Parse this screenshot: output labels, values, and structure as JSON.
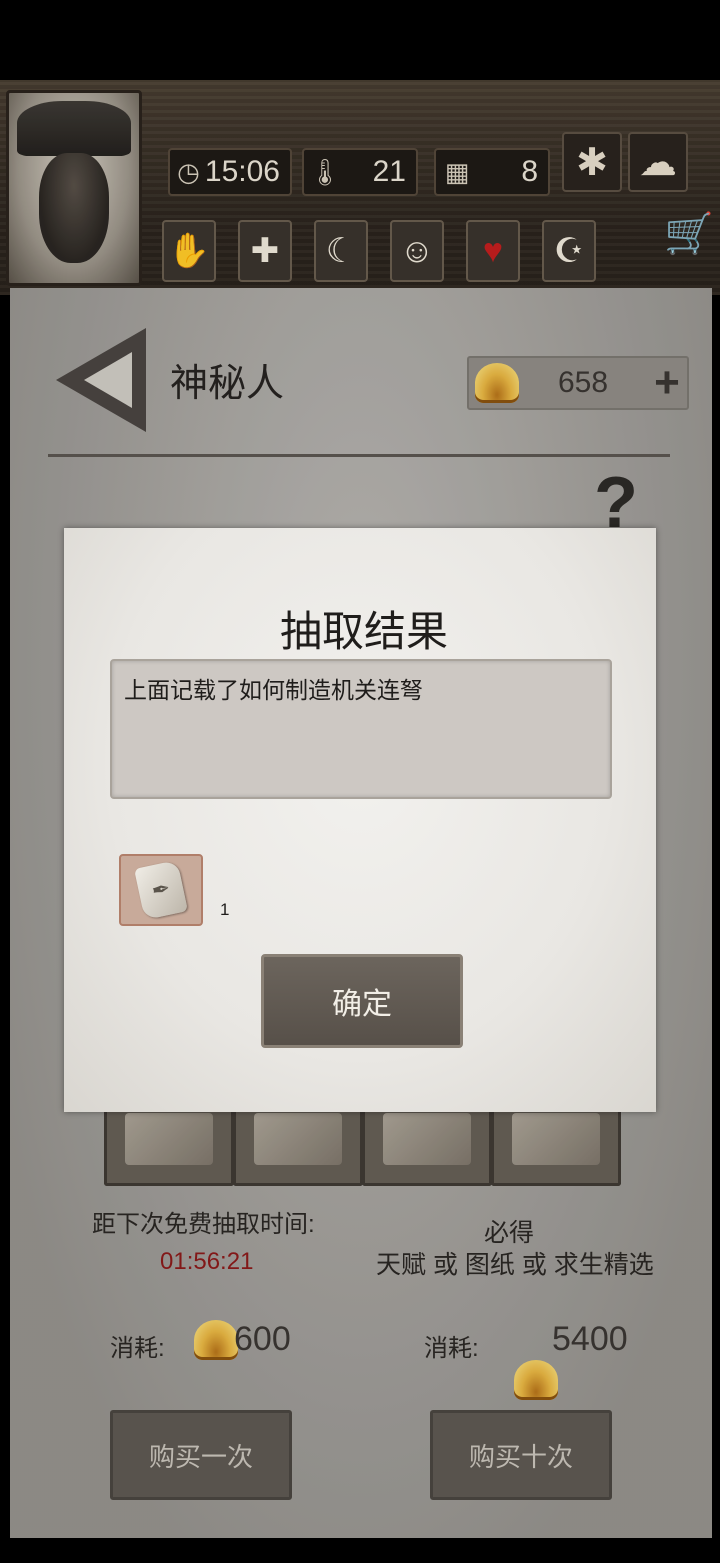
{
  "hud": {
    "time": "15:06",
    "temperature": "21",
    "day": "8",
    "icons": [
      "clock-icon",
      "thermometer-icon",
      "calendar-icon",
      "leaf-icon",
      "cloud-icon",
      "cart-icon"
    ],
    "status_icons": [
      "hand-icon",
      "cross-icon",
      "stomach-icon",
      "head-icon",
      "heart-icon",
      "moon-icon"
    ]
  },
  "header": {
    "title": "神秘人",
    "currency": "658"
  },
  "shop": {
    "free_draw_label": "距下次免费抽取时间:",
    "free_draw_timer": "01:56:21",
    "guaranteed_label": "必得",
    "guaranteed_desc": "天赋 或 图纸 或 求生精选",
    "cost_label_1": "消耗:",
    "cost_value_1": "600",
    "cost_label_10": "消耗:",
    "cost_value_10": "5400",
    "buy_once": "购买一次",
    "buy_ten": "购买十次"
  },
  "modal": {
    "title": "抽取结果",
    "result_text": "上面记载了如何制造机关连弩",
    "reward_count": "1",
    "confirm": "确定"
  },
  "colors": {
    "timer": "#8b1a1a",
    "shell": "#e7b542"
  }
}
